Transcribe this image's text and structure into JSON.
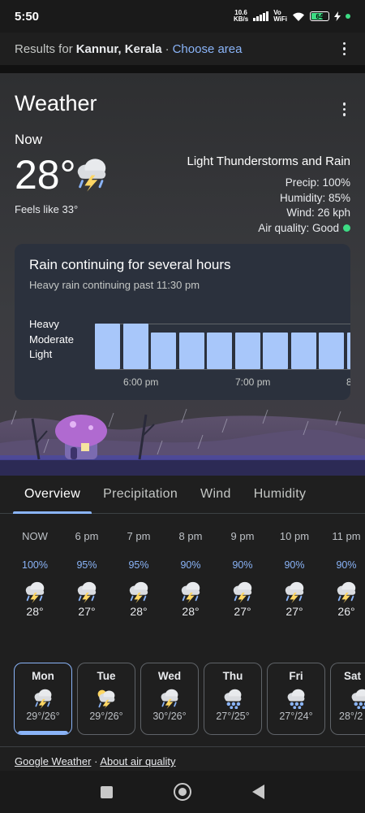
{
  "status": {
    "time": "5:50",
    "net_speed_value": "10.6",
    "net_speed_unit": "KB/s",
    "vowifi_top": "Vo",
    "vowifi_bottom": "WiFi",
    "battery": "64"
  },
  "results": {
    "prefix": "Results for",
    "location": "Kannur, Kerala",
    "separator": "·",
    "choose_area": "Choose area"
  },
  "weather": {
    "title": "Weather",
    "now_label": "Now",
    "temperature": "28°",
    "feels_like": "Feels like 33°",
    "condition": "Light Thunderstorms and Rain",
    "precip": "Precip: 100%",
    "humidity": "Humidity: 85%",
    "wind": "Wind: 26 kph",
    "air_quality": "Air quality: Good",
    "icon": "thunderstorm-rain-icon"
  },
  "rain_forecast": {
    "title": "Rain continuing for several hours",
    "subtitle": "Heavy rain continuing past 11:30 pm",
    "levels": [
      "Heavy",
      "Moderate",
      "Light"
    ],
    "time_labels": [
      "6:00 pm",
      "7:00 pm",
      "8"
    ],
    "bar_levels": [
      1.0,
      1.0,
      0.8,
      0.8,
      0.8,
      0.8,
      0.8,
      0.8,
      0.8,
      0.8
    ]
  },
  "tabs": [
    {
      "label": "Overview",
      "active": true
    },
    {
      "label": "Precipitation",
      "active": false
    },
    {
      "label": "Wind",
      "active": false
    },
    {
      "label": "Humidity",
      "active": false
    }
  ],
  "hourly": [
    {
      "time": "NOW",
      "precip": "100%",
      "temp": "28°",
      "icon": "thunderstorm-icon"
    },
    {
      "time": "6 pm",
      "precip": "95%",
      "temp": "27°",
      "icon": "thunderstorm-icon"
    },
    {
      "time": "7 pm",
      "precip": "95%",
      "temp": "28°",
      "icon": "thunderstorm-icon"
    },
    {
      "time": "8 pm",
      "precip": "90%",
      "temp": "28°",
      "icon": "thunderstorm-icon"
    },
    {
      "time": "9 pm",
      "precip": "90%",
      "temp": "27°",
      "icon": "thunderstorm-icon"
    },
    {
      "time": "10 pm",
      "precip": "90%",
      "temp": "27°",
      "icon": "thunderstorm-icon"
    },
    {
      "time": "11 pm",
      "precip": "90%",
      "temp": "26°",
      "icon": "thunderstorm-icon"
    }
  ],
  "daily": [
    {
      "day": "Mon",
      "temps": "29°/26°",
      "icon": "thunderstorm-icon",
      "selected": true
    },
    {
      "day": "Tue",
      "temps": "29°/26°",
      "icon": "sun-thunderstorm-icon",
      "selected": false
    },
    {
      "day": "Wed",
      "temps": "30°/26°",
      "icon": "thunderstorm-icon",
      "selected": false
    },
    {
      "day": "Thu",
      "temps": "27°/25°",
      "icon": "rain-icon",
      "selected": false
    },
    {
      "day": "Fri",
      "temps": "27°/24°",
      "icon": "rain-icon",
      "selected": false
    },
    {
      "day": "Sat",
      "temps": "28°/2",
      "icon": "rain-icon",
      "selected": false
    }
  ],
  "footer": {
    "source_link": "Google Weather",
    "separator": "·",
    "aq_link": "About air quality"
  },
  "colors": {
    "accent": "#8ab4f8",
    "rain_bar": "#a8c7fa",
    "good_air": "#3ddc84"
  }
}
